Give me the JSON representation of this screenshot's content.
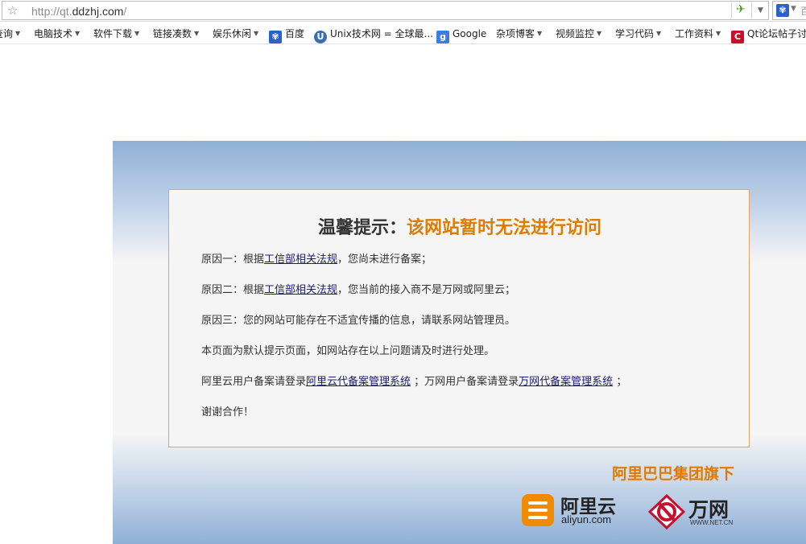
{
  "browser": {
    "url_prefix": "http://qt.",
    "url_domain": "ddzhj.com",
    "url_suffix": "/",
    "star_icon": "☆",
    "go_icon": "✈",
    "search_hint": "百"
  },
  "bookmarks": [
    {
      "label": "查询",
      "dropdown": true
    },
    {
      "label": "电脑技术",
      "dropdown": true
    },
    {
      "label": "软件下载",
      "dropdown": true
    },
    {
      "label": "链接凑数",
      "dropdown": true
    },
    {
      "label": "娱乐休闲",
      "dropdown": true
    },
    {
      "label": "百度",
      "icon": "baidu-paw-icon"
    },
    {
      "label": "Unix技术网 = 全球最...",
      "icon": "unix-icon"
    },
    {
      "label": "Google",
      "icon": "google-icon"
    },
    {
      "label": "杂项博客",
      "dropdown": true
    },
    {
      "label": "视频监控",
      "dropdown": true
    },
    {
      "label": "学习代码",
      "dropdown": true
    },
    {
      "label": "工作资料",
      "dropdown": true
    },
    {
      "label": "Qt论坛帖子讨",
      "icon": "csdn-icon"
    }
  ],
  "notice": {
    "title_prefix": "温馨提示：",
    "title_highlight": "该网站暂时无法进行访问",
    "reason1": {
      "a": "原因一：根据",
      "link": "工信部相关法规",
      "b": "，您尚未进行备案；"
    },
    "reason2": {
      "a": "原因二：根据",
      "link": "工信部相关法规",
      "b": "，您当前的接入商不是万网或阿里云；"
    },
    "reason3": "原因三：您的网站可能存在不适宜传播的信息，请联系网站管理员。",
    "default_page": "本页面为默认提示页面，如网站存在以上问题请及时进行处理。",
    "aliyun_line": {
      "a": "阿里云用户备案请登录",
      "link1": "阿里云代备案管理系统",
      "b": " ；万网用户备案请登录",
      "link2": "万网代备案管理系统",
      "c": " ；"
    },
    "thanks": "谢谢合作！"
  },
  "footer": {
    "group_label": "阿里巴巴集团旗下",
    "aliyun_name": "阿里云",
    "aliyun_domain": "aliyun.com",
    "wanwang_name": "万网",
    "wanwang_domain": "WWW.NET.CN"
  },
  "colors": {
    "accent_orange": "#e07b00",
    "link": "#20206a",
    "panel_border": "#e0a468",
    "bg_blue": "#8fb0d6"
  }
}
